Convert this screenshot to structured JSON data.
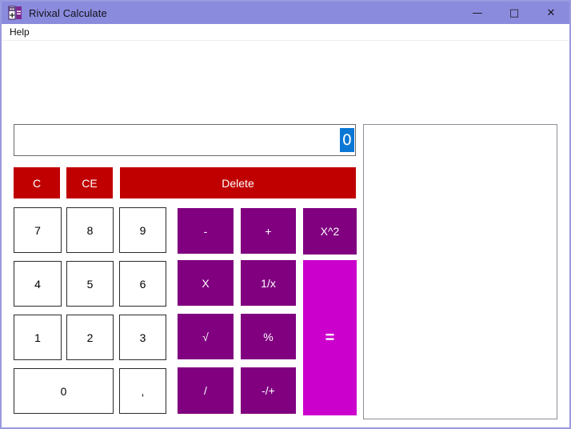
{
  "window": {
    "title": "Rivixal Calculate",
    "icon": "calculator-icon",
    "titlebar_color": "#8b8bde",
    "border_color": "#9a9ae0",
    "controls": {
      "minimize": "—",
      "maximize": "□",
      "close": "✕"
    }
  },
  "menubar": {
    "items": [
      {
        "label": "Help"
      }
    ]
  },
  "display": {
    "value": "0",
    "selected": true,
    "selection_bg": "#0b77d4",
    "selection_fg": "#ffffff"
  },
  "history": {
    "entries": [],
    "border_color": "#8a8f98"
  },
  "colors": {
    "clear_red": "#c00000",
    "operator_purple": "#800080",
    "equals_magenta": "#cc00cc",
    "number_bg": "#ffffff",
    "number_border": "#2b2b2b"
  },
  "keys": {
    "clear": [
      {
        "label": "C",
        "name": "clear-button"
      },
      {
        "label": "CE",
        "name": "clear-entry-button"
      },
      {
        "label": "Delete",
        "name": "delete-button"
      }
    ],
    "numbers": [
      {
        "label": "7",
        "name": "digit-7-button"
      },
      {
        "label": "8",
        "name": "digit-8-button"
      },
      {
        "label": "9",
        "name": "digit-9-button"
      },
      {
        "label": "4",
        "name": "digit-4-button"
      },
      {
        "label": "5",
        "name": "digit-5-button"
      },
      {
        "label": "6",
        "name": "digit-6-button"
      },
      {
        "label": "1",
        "name": "digit-1-button"
      },
      {
        "label": "2",
        "name": "digit-2-button"
      },
      {
        "label": "3",
        "name": "digit-3-button"
      },
      {
        "label": "0",
        "name": "digit-0-button"
      },
      {
        "label": ",",
        "name": "decimal-comma-button"
      }
    ],
    "operators": [
      {
        "label": "-",
        "name": "subtract-button"
      },
      {
        "label": "+",
        "name": "add-button"
      },
      {
        "label": "X^2",
        "name": "square-button"
      },
      {
        "label": "X",
        "name": "multiply-button"
      },
      {
        "label": "1/x",
        "name": "reciprocal-button"
      },
      {
        "label": "√",
        "name": "square-root-button"
      },
      {
        "label": "%",
        "name": "percent-button"
      },
      {
        "label": "/",
        "name": "divide-button"
      },
      {
        "label": "-/+",
        "name": "sign-toggle-button"
      }
    ],
    "equals": {
      "label": "=",
      "name": "equals-button"
    }
  }
}
